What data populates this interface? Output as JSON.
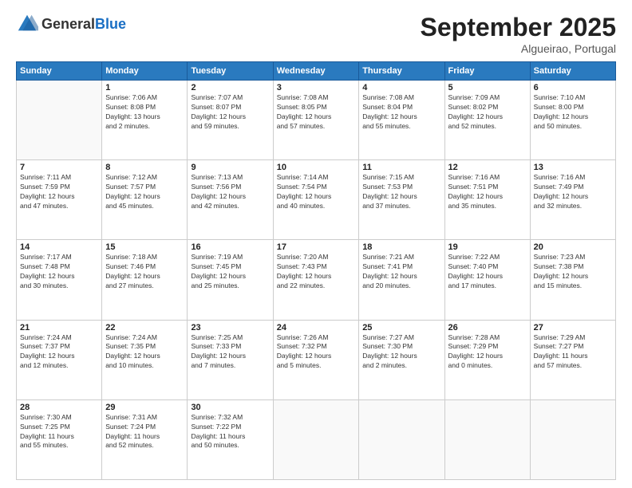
{
  "header": {
    "logo_general": "General",
    "logo_blue": "Blue",
    "title": "September 2025",
    "location": "Algueirao, Portugal"
  },
  "days_of_week": [
    "Sunday",
    "Monday",
    "Tuesday",
    "Wednesday",
    "Thursday",
    "Friday",
    "Saturday"
  ],
  "weeks": [
    [
      {
        "day": "",
        "info": ""
      },
      {
        "day": "1",
        "info": "Sunrise: 7:06 AM\nSunset: 8:08 PM\nDaylight: 13 hours\nand 2 minutes."
      },
      {
        "day": "2",
        "info": "Sunrise: 7:07 AM\nSunset: 8:07 PM\nDaylight: 12 hours\nand 59 minutes."
      },
      {
        "day": "3",
        "info": "Sunrise: 7:08 AM\nSunset: 8:05 PM\nDaylight: 12 hours\nand 57 minutes."
      },
      {
        "day": "4",
        "info": "Sunrise: 7:08 AM\nSunset: 8:04 PM\nDaylight: 12 hours\nand 55 minutes."
      },
      {
        "day": "5",
        "info": "Sunrise: 7:09 AM\nSunset: 8:02 PM\nDaylight: 12 hours\nand 52 minutes."
      },
      {
        "day": "6",
        "info": "Sunrise: 7:10 AM\nSunset: 8:00 PM\nDaylight: 12 hours\nand 50 minutes."
      }
    ],
    [
      {
        "day": "7",
        "info": "Sunrise: 7:11 AM\nSunset: 7:59 PM\nDaylight: 12 hours\nand 47 minutes."
      },
      {
        "day": "8",
        "info": "Sunrise: 7:12 AM\nSunset: 7:57 PM\nDaylight: 12 hours\nand 45 minutes."
      },
      {
        "day": "9",
        "info": "Sunrise: 7:13 AM\nSunset: 7:56 PM\nDaylight: 12 hours\nand 42 minutes."
      },
      {
        "day": "10",
        "info": "Sunrise: 7:14 AM\nSunset: 7:54 PM\nDaylight: 12 hours\nand 40 minutes."
      },
      {
        "day": "11",
        "info": "Sunrise: 7:15 AM\nSunset: 7:53 PM\nDaylight: 12 hours\nand 37 minutes."
      },
      {
        "day": "12",
        "info": "Sunrise: 7:16 AM\nSunset: 7:51 PM\nDaylight: 12 hours\nand 35 minutes."
      },
      {
        "day": "13",
        "info": "Sunrise: 7:16 AM\nSunset: 7:49 PM\nDaylight: 12 hours\nand 32 minutes."
      }
    ],
    [
      {
        "day": "14",
        "info": "Sunrise: 7:17 AM\nSunset: 7:48 PM\nDaylight: 12 hours\nand 30 minutes."
      },
      {
        "day": "15",
        "info": "Sunrise: 7:18 AM\nSunset: 7:46 PM\nDaylight: 12 hours\nand 27 minutes."
      },
      {
        "day": "16",
        "info": "Sunrise: 7:19 AM\nSunset: 7:45 PM\nDaylight: 12 hours\nand 25 minutes."
      },
      {
        "day": "17",
        "info": "Sunrise: 7:20 AM\nSunset: 7:43 PM\nDaylight: 12 hours\nand 22 minutes."
      },
      {
        "day": "18",
        "info": "Sunrise: 7:21 AM\nSunset: 7:41 PM\nDaylight: 12 hours\nand 20 minutes."
      },
      {
        "day": "19",
        "info": "Sunrise: 7:22 AM\nSunset: 7:40 PM\nDaylight: 12 hours\nand 17 minutes."
      },
      {
        "day": "20",
        "info": "Sunrise: 7:23 AM\nSunset: 7:38 PM\nDaylight: 12 hours\nand 15 minutes."
      }
    ],
    [
      {
        "day": "21",
        "info": "Sunrise: 7:24 AM\nSunset: 7:37 PM\nDaylight: 12 hours\nand 12 minutes."
      },
      {
        "day": "22",
        "info": "Sunrise: 7:24 AM\nSunset: 7:35 PM\nDaylight: 12 hours\nand 10 minutes."
      },
      {
        "day": "23",
        "info": "Sunrise: 7:25 AM\nSunset: 7:33 PM\nDaylight: 12 hours\nand 7 minutes."
      },
      {
        "day": "24",
        "info": "Sunrise: 7:26 AM\nSunset: 7:32 PM\nDaylight: 12 hours\nand 5 minutes."
      },
      {
        "day": "25",
        "info": "Sunrise: 7:27 AM\nSunset: 7:30 PM\nDaylight: 12 hours\nand 2 minutes."
      },
      {
        "day": "26",
        "info": "Sunrise: 7:28 AM\nSunset: 7:29 PM\nDaylight: 12 hours\nand 0 minutes."
      },
      {
        "day": "27",
        "info": "Sunrise: 7:29 AM\nSunset: 7:27 PM\nDaylight: 11 hours\nand 57 minutes."
      }
    ],
    [
      {
        "day": "28",
        "info": "Sunrise: 7:30 AM\nSunset: 7:25 PM\nDaylight: 11 hours\nand 55 minutes."
      },
      {
        "day": "29",
        "info": "Sunrise: 7:31 AM\nSunset: 7:24 PM\nDaylight: 11 hours\nand 52 minutes."
      },
      {
        "day": "30",
        "info": "Sunrise: 7:32 AM\nSunset: 7:22 PM\nDaylight: 11 hours\nand 50 minutes."
      },
      {
        "day": "",
        "info": ""
      },
      {
        "day": "",
        "info": ""
      },
      {
        "day": "",
        "info": ""
      },
      {
        "day": "",
        "info": ""
      }
    ]
  ]
}
